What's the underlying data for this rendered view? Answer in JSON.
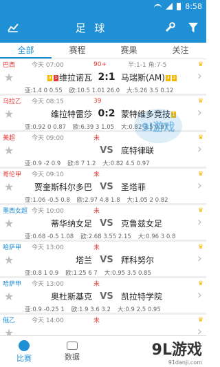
{
  "status_bar": {
    "time": "8:58"
  },
  "header": {
    "title": "足 球"
  },
  "tabs": [
    {
      "label": "全部",
      "active": true
    },
    {
      "label": "赛程",
      "active": false
    },
    {
      "label": "赛果",
      "active": false
    },
    {
      "label": "关注",
      "active": false
    }
  ],
  "matches": [
    {
      "league": "巴西",
      "league_color": "#e53935",
      "time": "今天 07:00",
      "status": "90+",
      "half": "半:1-1  角:7-5",
      "home_cards": [
        "3",
        "1"
      ],
      "home": "维拉诺瓦",
      "score": "2:1",
      "away": "马瑞斯(AM)",
      "away_cards": [
        "3",
        "2"
      ],
      "odds": [
        "亚:1.4 0 0.55",
        "欧:10.5 1.01 26.0",
        "大:5.26 3.5 0.12"
      ]
    },
    {
      "league": "乌拉乙",
      "league_color": "#e53935",
      "time": "今天 08:15",
      "status": "39",
      "half": "",
      "home_cards": [],
      "home": "维拉特雷莎",
      "score": "0:2",
      "away": "蒙特维多竞技",
      "away_cards": [
        "1"
      ],
      "odds": [
        "亚:0.92 0 0.87",
        "欧:6.39 3 1.05",
        "大:0.82 3.5 0.97"
      ]
    },
    {
      "league": "美超",
      "league_color": "#e53935",
      "time": "今天 09:00",
      "status": "未",
      "half": "",
      "home_cards": [],
      "home": "",
      "score": "VS",
      "away": "底特律联",
      "away_cards": [],
      "odds": [
        "亚:0.9 -2 0.9",
        "欧:8 7 1.2",
        "大:0.82 4.5 0.97"
      ]
    },
    {
      "league": "哥伦甲",
      "league_color": "#e53935",
      "time": "今天 09:10",
      "status": "未",
      "half": "",
      "home_cards": [],
      "home": "贾奎斯科尔多巴",
      "score": "VS",
      "away": "圣塔菲",
      "away_cards": [],
      "odds": [
        "亚:1.06 -0.5 0.8",
        "欧:2.97 4.8 1.8",
        "大:1.05 2 0.82"
      ]
    },
    {
      "league": "墨西女超",
      "league_color": "#1f8fd6",
      "time": "今天 10:00",
      "status": "未",
      "half": "",
      "home_cards": [],
      "home": "蒂华纳女足",
      "score": "VS",
      "away": "克鲁兹女足",
      "away_cards": [],
      "odds": [
        "亚:0.68 -0.5 1.08",
        "欧:2.68 3.55 2.15",
        "大:0.96 3 0.8"
      ]
    },
    {
      "league": "哈萨甲",
      "league_color": "#1f8fd6",
      "time": "今天 13:00",
      "status": "未",
      "half": "",
      "home_cards": [],
      "home": "塔兰",
      "score": "VS",
      "away": "拜科努尔",
      "away_cards": [],
      "odds": [
        "亚:0.8 1 0.9",
        "欧:1.25 6 7",
        "大:0.95 3.5 0.85"
      ]
    },
    {
      "league": "哈萨甲",
      "league_color": "#1f8fd6",
      "time": "今天 13:00",
      "status": "未",
      "half": "",
      "home_cards": [],
      "home": "奥杜斯基克",
      "score": "VS",
      "away": "凯拉特学院",
      "away_cards": [],
      "odds": [
        "亚:0.9 -0.25 1",
        "欧:1.9 3.6 3.2",
        "大:0.9 2.5 0.95"
      ]
    },
    {
      "league": "俄乙",
      "league_color": "#1f8fd6",
      "time": "今天 14:00",
      "status": "未",
      "half": "",
      "home_cards": [],
      "home": "",
      "score": "",
      "away": "",
      "away_cards": [],
      "odds": [
        "",
        "",
        ""
      ]
    }
  ],
  "bottom_nav": [
    {
      "label": "比赛",
      "active": true
    },
    {
      "label": "数据",
      "active": false
    }
  ],
  "watermark": {
    "main": "9L游戏",
    "sub": "91danji.com",
    "mid": "9l游戏"
  },
  "colors": {
    "primary": "#1f8fd6",
    "red": "#e53935",
    "green": "#2e9d3c",
    "yellow_card": "#f5b800"
  }
}
